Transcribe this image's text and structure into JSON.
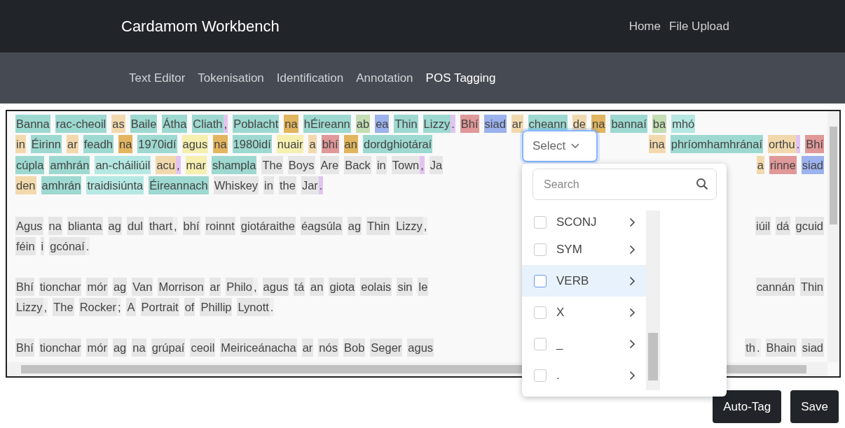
{
  "header": {
    "brand": "Cardamom Workbench",
    "links": [
      "Home",
      "File Upload"
    ]
  },
  "nav": {
    "tabs": [
      {
        "label": "Text Editor",
        "selected": false
      },
      {
        "label": "Tokenisation",
        "selected": false
      },
      {
        "label": "Identification",
        "selected": false
      },
      {
        "label": "Annotation",
        "selected": false
      },
      {
        "label": "POS Tagging",
        "selected": true
      }
    ]
  },
  "editor": {
    "paragraphs": [
      {
        "lines": [
          {
            "left": [
              {
                "text": "Banna",
                "kind": "word",
                "color": "#9dd9d0"
              },
              {
                "text": "rac-cheoil",
                "kind": "word",
                "color": "#9dd9d0"
              },
              {
                "text": "as",
                "kind": "word",
                "color": "#f2d9ad"
              },
              {
                "text": "Baile",
                "kind": "word",
                "color": "#9dd9d0"
              },
              {
                "text": "Átha",
                "kind": "word",
                "color": "#9dd9d0"
              },
              {
                "text": "Cliath",
                "kind": "word",
                "color": "#9dd9d0"
              },
              {
                "text": ",",
                "kind": "punct",
                "color": "#e3c4f0"
              },
              {
                "text": "Poblacht",
                "kind": "word",
                "color": "#9dd9d0"
              },
              {
                "text": "na",
                "kind": "word",
                "color": "#e2b55e"
              },
              {
                "text": "hÉireann",
                "kind": "word",
                "color": "#9dd9d0"
              },
              {
                "text": "ab",
                "kind": "word",
                "color": "#c3deb3"
              },
              {
                "text": "ea",
                "kind": "word",
                "color": "#9cb2ee"
              },
              {
                "text": "Thin",
                "kind": "word",
                "color": "#9dd9d0"
              },
              {
                "text": "Lizzy",
                "kind": "word",
                "color": "#9dd9d0"
              },
              {
                "text": ".",
                "kind": "punct",
                "color": "#e3c4f0"
              },
              {
                "text": "Bhí",
                "kind": "word",
                "color": "#e09898"
              },
              {
                "text": "siad",
                "kind": "word",
                "color": "#9cb2ee"
              },
              {
                "text": "ar",
                "kind": "word",
                "color": "#f2d9ad"
              },
              {
                "text": "cheann",
                "kind": "word",
                "color": "#9dd9d0"
              },
              {
                "text": "de",
                "kind": "word",
                "color": "#f2d9ad"
              },
              {
                "text": "na",
                "kind": "word",
                "color": "#e2b55e"
              },
              {
                "text": "bannaí",
                "kind": "word",
                "color": "#9dd9d0"
              },
              {
                "text": "ba",
                "kind": "word",
                "color": "#c3deb3"
              },
              {
                "text": "mhó",
                "kind": "word",
                "color": "#b5e8e2"
              }
            ]
          },
          {
            "left": [
              {
                "text": "in",
                "kind": "word",
                "color": "#f2d9ad"
              },
              {
                "text": "Éirinn",
                "kind": "word",
                "color": "#9dd9d0"
              },
              {
                "text": "ar",
                "kind": "word",
                "color": "#f2d9ad"
              },
              {
                "text": "feadh",
                "kind": "word",
                "color": "#9dd9d0"
              },
              {
                "text": "na",
                "kind": "word",
                "color": "#e2b55e"
              },
              {
                "text": "1970idí",
                "kind": "word",
                "color": "#9dd9d0"
              },
              {
                "text": "agus",
                "kind": "word",
                "color": "#f5efb0"
              },
              {
                "text": "na",
                "kind": "word",
                "color": "#e2b55e"
              },
              {
                "text": "1980idí",
                "kind": "word",
                "color": "#9dd9d0"
              },
              {
                "text": "nuair",
                "kind": "word",
                "color": "#f5efb0"
              },
              {
                "text": "a",
                "kind": "word",
                "color": "#f2d9ad"
              },
              {
                "text": "bhí",
                "kind": "word",
                "color": "#e09898"
              },
              {
                "text": "an",
                "kind": "word",
                "color": "#e2b55e"
              },
              {
                "text": "dordghiotáraí",
                "kind": "word",
                "color": "#9dd9d0"
              }
            ],
            "right": [
              {
                "text": "ina",
                "kind": "word",
                "color": "#f2d9ad"
              },
              {
                "text": "phríomhamhránaí",
                "kind": "word",
                "color": "#9dd9d0"
              },
              {
                "text": "orthu",
                "kind": "word",
                "color": "#f2d9ad"
              },
              {
                "text": ".",
                "kind": "punct",
                "color": "#e3c4f0"
              },
              {
                "text": "Bhí",
                "kind": "word",
                "color": "#e09898"
              }
            ]
          },
          {
            "left": [
              {
                "text": "cúpla",
                "kind": "word",
                "color": "#9dd9d0"
              },
              {
                "text": "amhrán",
                "kind": "word",
                "color": "#9dd9d0"
              },
              {
                "text": "an-cháiliúil",
                "kind": "word",
                "color": "#b5e8e2"
              },
              {
                "text": "acu",
                "kind": "word",
                "color": "#f2d9ad"
              },
              {
                "text": ",",
                "kind": "punct",
                "color": "#e3c4f0"
              },
              {
                "text": "mar",
                "kind": "word",
                "color": "#f5efb0"
              },
              {
                "text": "shampla",
                "kind": "word",
                "color": "#9dd9d0"
              },
              {
                "text": "The",
                "kind": "word",
                "color": "#e6e6e6"
              },
              {
                "text": "Boys",
                "kind": "word",
                "color": "#e6e6e6"
              },
              {
                "text": "Are",
                "kind": "word",
                "color": "#e6e6e6"
              },
              {
                "text": "Back",
                "kind": "word",
                "color": "#e6e6e6"
              },
              {
                "text": "in",
                "kind": "word",
                "color": "#e6e6e6"
              },
              {
                "text": "Town",
                "kind": "word",
                "color": "#e6e6e6"
              },
              {
                "text": ",",
                "kind": "punct",
                "color": "#e3c4f0"
              },
              {
                "text": "Ja",
                "kind": "word",
                "color": "#e6e6e6"
              }
            ],
            "right": [
              {
                "text": "a",
                "kind": "word",
                "color": "#f2d9ad"
              },
              {
                "text": "rinne",
                "kind": "word",
                "color": "#e09898"
              },
              {
                "text": "siad",
                "kind": "word",
                "color": "#9cb2ee"
              }
            ]
          },
          {
            "left": [
              {
                "text": "den",
                "kind": "word",
                "color": "#f2d9ad"
              },
              {
                "text": "amhrán",
                "kind": "word",
                "color": "#9dd9d0"
              },
              {
                "text": "traidisiúnta",
                "kind": "word",
                "color": "#b5e8e2"
              },
              {
                "text": "Éireannach",
                "kind": "word",
                "color": "#9dd9d0"
              },
              {
                "text": "Whiskey",
                "kind": "word",
                "color": "#e6e6e6"
              },
              {
                "text": "in",
                "kind": "word",
                "color": "#e6e6e6"
              },
              {
                "text": "the",
                "kind": "word",
                "color": "#e6e6e6"
              },
              {
                "text": "Jar",
                "kind": "word",
                "color": "#e6e6e6"
              },
              {
                "text": ".",
                "kind": "punct",
                "color": "#e3c4f0"
              }
            ]
          }
        ]
      },
      {
        "lines": [
          {
            "left": [
              {
                "text": "Agus",
                "kind": "word",
                "color": "#e6e6e6"
              },
              {
                "text": "na",
                "kind": "word",
                "color": "#e6e6e6"
              },
              {
                "text": "blianta",
                "kind": "word",
                "color": "#e6e6e6"
              },
              {
                "text": "ag",
                "kind": "word",
                "color": "#e6e6e6"
              },
              {
                "text": "dul",
                "kind": "word",
                "color": "#e6e6e6"
              },
              {
                "text": "thart",
                "kind": "word",
                "color": "#e6e6e6"
              },
              {
                "text": ",",
                "kind": "punct",
                "color": "#f0f0f0"
              },
              {
                "text": "bhí",
                "kind": "word",
                "color": "#e6e6e6"
              },
              {
                "text": "roinnt",
                "kind": "word",
                "color": "#e6e6e6"
              },
              {
                "text": "giotáraithe",
                "kind": "word",
                "color": "#e6e6e6"
              },
              {
                "text": "éagsúla",
                "kind": "word",
                "color": "#e6e6e6"
              },
              {
                "text": "ag",
                "kind": "word",
                "color": "#e6e6e6"
              },
              {
                "text": "Thin",
                "kind": "word",
                "color": "#e6e6e6"
              },
              {
                "text": "Lizzy",
                "kind": "word",
                "color": "#e6e6e6"
              },
              {
                "text": ",",
                "kind": "punct",
                "color": "#f0f0f0"
              }
            ],
            "right": [
              {
                "text": "iúil",
                "kind": "word",
                "color": "#e6e6e6"
              },
              {
                "text": "dá",
                "kind": "word",
                "color": "#e6e6e6"
              },
              {
                "text": "gcuid",
                "kind": "word",
                "color": "#e6e6e6"
              }
            ]
          },
          {
            "left": [
              {
                "text": "féin",
                "kind": "word",
                "color": "#e6e6e6"
              },
              {
                "text": "i",
                "kind": "word",
                "color": "#e6e6e6"
              },
              {
                "text": "gcónaí",
                "kind": "word",
                "color": "#e6e6e6"
              },
              {
                "text": ".",
                "kind": "punct",
                "color": "#f0f0f0"
              }
            ]
          }
        ]
      },
      {
        "lines": [
          {
            "left": [
              {
                "text": "Bhí",
                "kind": "word",
                "color": "#e6e6e6"
              },
              {
                "text": "tionchar",
                "kind": "word",
                "color": "#e6e6e6"
              },
              {
                "text": "mór",
                "kind": "word",
                "color": "#e6e6e6"
              },
              {
                "text": "ag",
                "kind": "word",
                "color": "#e6e6e6"
              },
              {
                "text": "Van",
                "kind": "word",
                "color": "#e6e6e6"
              },
              {
                "text": "Morrison",
                "kind": "word",
                "color": "#e6e6e6"
              },
              {
                "text": "ar",
                "kind": "word",
                "color": "#e6e6e6"
              },
              {
                "text": "Philo",
                "kind": "word",
                "color": "#e6e6e6"
              },
              {
                "text": ",",
                "kind": "punct",
                "color": "#f0f0f0"
              },
              {
                "text": "agus",
                "kind": "word",
                "color": "#e6e6e6"
              },
              {
                "text": "tá",
                "kind": "word",
                "color": "#e6e6e6"
              },
              {
                "text": "an",
                "kind": "word",
                "color": "#e6e6e6"
              },
              {
                "text": "giota",
                "kind": "word",
                "color": "#e6e6e6"
              },
              {
                "text": "eolais",
                "kind": "word",
                "color": "#e6e6e6"
              },
              {
                "text": "sin",
                "kind": "word",
                "color": "#e6e6e6"
              },
              {
                "text": "le",
                "kind": "word",
                "color": "#e6e6e6"
              }
            ],
            "right": [
              {
                "text": "cannán",
                "kind": "word",
                "color": "#e6e6e6"
              },
              {
                "text": "Thin",
                "kind": "word",
                "color": "#e6e6e6"
              }
            ]
          },
          {
            "left": [
              {
                "text": "Lizzy",
                "kind": "word",
                "color": "#e6e6e6"
              },
              {
                "text": ",",
                "kind": "punct",
                "color": "#f0f0f0"
              },
              {
                "text": "The",
                "kind": "word",
                "color": "#e6e6e6"
              },
              {
                "text": "Rocker",
                "kind": "word",
                "color": "#e6e6e6"
              },
              {
                "text": ";",
                "kind": "punct",
                "color": "#f0f0f0"
              },
              {
                "text": "A",
                "kind": "word",
                "color": "#e6e6e6"
              },
              {
                "text": "Portrait",
                "kind": "word",
                "color": "#e6e6e6"
              },
              {
                "text": "of",
                "kind": "word",
                "color": "#e6e6e6"
              },
              {
                "text": "Phillip",
                "kind": "word",
                "color": "#e6e6e6"
              },
              {
                "text": "Lynott",
                "kind": "word",
                "color": "#e6e6e6"
              },
              {
                "text": ".",
                "kind": "punct",
                "color": "#f0f0f0"
              }
            ]
          }
        ]
      },
      {
        "lines": [
          {
            "left": [
              {
                "text": "Bhí",
                "kind": "word",
                "color": "#e6e6e6"
              },
              {
                "text": "tionchar",
                "kind": "word",
                "color": "#e6e6e6"
              },
              {
                "text": "mór",
                "kind": "word",
                "color": "#e6e6e6"
              },
              {
                "text": "ag",
                "kind": "word",
                "color": "#e6e6e6"
              },
              {
                "text": "na",
                "kind": "word",
                "color": "#e6e6e6"
              },
              {
                "text": "grúpaí",
                "kind": "word",
                "color": "#e6e6e6"
              },
              {
                "text": "ceoil",
                "kind": "word",
                "color": "#e6e6e6"
              },
              {
                "text": "Meiriceánacha",
                "kind": "word",
                "color": "#e6e6e6"
              },
              {
                "text": "ar",
                "kind": "word",
                "color": "#e6e6e6"
              },
              {
                "text": "nós",
                "kind": "word",
                "color": "#e6e6e6"
              },
              {
                "text": "Bob",
                "kind": "word",
                "color": "#e6e6e6"
              },
              {
                "text": "Seger",
                "kind": "word",
                "color": "#e6e6e6"
              },
              {
                "text": "agus",
                "kind": "word",
                "color": "#e6e6e6"
              }
            ],
            "right": [
              {
                "text": "th",
                "kind": "word",
                "color": "#e6e6e6"
              },
              {
                "text": ".",
                "kind": "punct",
                "color": "#f0f0f0"
              },
              {
                "text": "Bhain",
                "kind": "word",
                "color": "#e6e6e6"
              },
              {
                "text": "siad",
                "kind": "word",
                "color": "#e6e6e6"
              }
            ]
          }
        ]
      }
    ]
  },
  "tag_picker": {
    "button": "Select",
    "search": {
      "placeholder": "Search"
    },
    "options": [
      {
        "label": "SCONJ",
        "checked": false,
        "selected": false
      },
      {
        "label": "SYM",
        "checked": false,
        "selected": false
      },
      {
        "label": "VERB",
        "checked": false,
        "selected": true
      },
      {
        "label": "X",
        "checked": false,
        "selected": false
      },
      {
        "label": "_",
        "checked": false,
        "selected": false
      },
      {
        "label": ".",
        "checked": false,
        "selected": false
      }
    ]
  },
  "actions": [
    "Auto-Tag",
    "Save"
  ]
}
